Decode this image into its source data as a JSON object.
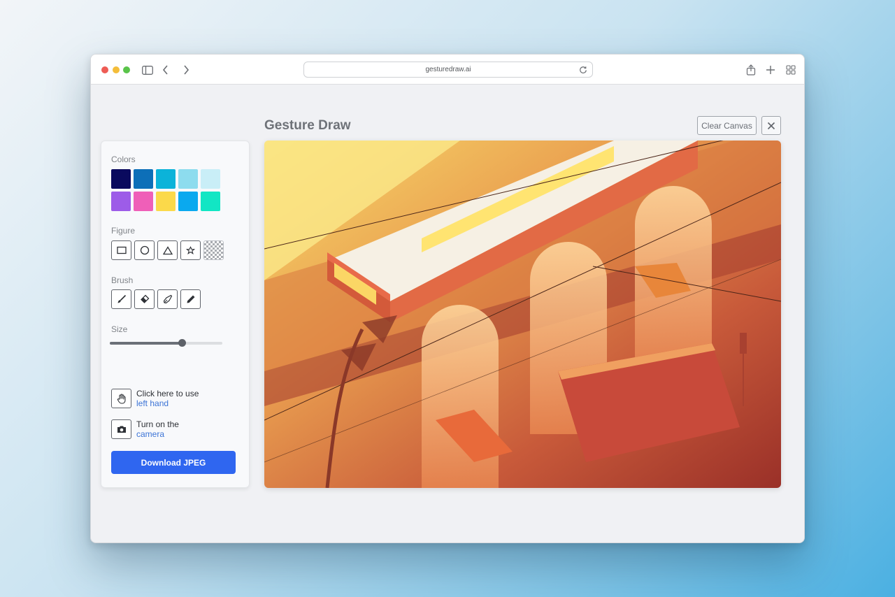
{
  "browser": {
    "url": "gesturedraw.ai"
  },
  "app": {
    "title": "Gesture Draw",
    "clear_label": "Clear Canvas"
  },
  "panel": {
    "colors_label": "Colors",
    "colors": [
      "#0a0a5e",
      "#0d6fb8",
      "#0bb3d9",
      "#8ddcee",
      "#c9eef7",
      "#9d5ce8",
      "#ef5fb8",
      "#fbd94a",
      "#0aa9ef",
      "#12e6c4"
    ],
    "figure_label": "Figure",
    "figures": [
      "rectangle-icon",
      "circle-icon",
      "triangle-icon",
      "star-icon",
      "transparent-icon"
    ],
    "brush_label": "Brush",
    "brushes": [
      "brush-icon",
      "eraser-icon",
      "pen-icon",
      "pencil-icon"
    ],
    "size_label": "Size",
    "size_value": 0.64,
    "hand_option": {
      "line1": "Click here to use",
      "link": "left hand"
    },
    "camera_option": {
      "line1": "Turn on the",
      "link": "camera"
    },
    "download_label": "Download JPEG"
  },
  "canvas": {
    "content": "illustration"
  }
}
